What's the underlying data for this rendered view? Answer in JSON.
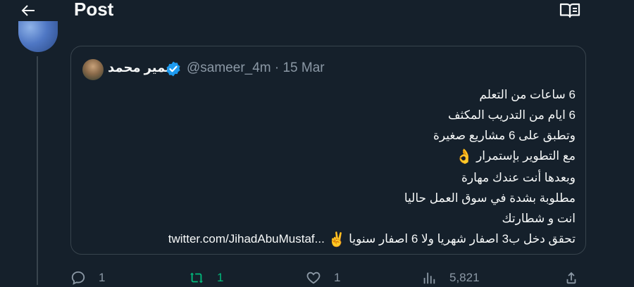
{
  "header": {
    "title": "Post",
    "back_icon": "arrow-left-icon",
    "reader_icon": "book-open-icon"
  },
  "quote": {
    "author_name": "سمير محمد",
    "handle_date": "@sameer_4m · 15 Mar",
    "verified_icon": "verified-badge-icon",
    "lines": [
      "6 ساعات من التعلم",
      "6 ايام من التدريب المكثف",
      "وتطبق على 6 مشاريع صغيرة",
      "مع التطوير بإستمرار",
      "وبعدها أنت عندك مهارة",
      "مطلوبة بشدة في سوق العمل حاليا",
      "انت و شطارتك",
      "تحقق دخل ب3 اصفار شهريا ولا 6 اصفار سنويا"
    ],
    "ok_hand_emoji": "👌",
    "victory_emoji": "✌️",
    "link": "twitter.com/JihadAbuMustaf..."
  },
  "actions": {
    "reply_count": "1",
    "repost_count": "1",
    "like_count": "1",
    "views_count": "5,821"
  },
  "colors": {
    "background": "#15202b",
    "border": "#38444d",
    "text": "#e7e9ea",
    "muted": "#8b98a5",
    "verified": "#1d9bf0",
    "repost_active": "#00ba7c"
  }
}
